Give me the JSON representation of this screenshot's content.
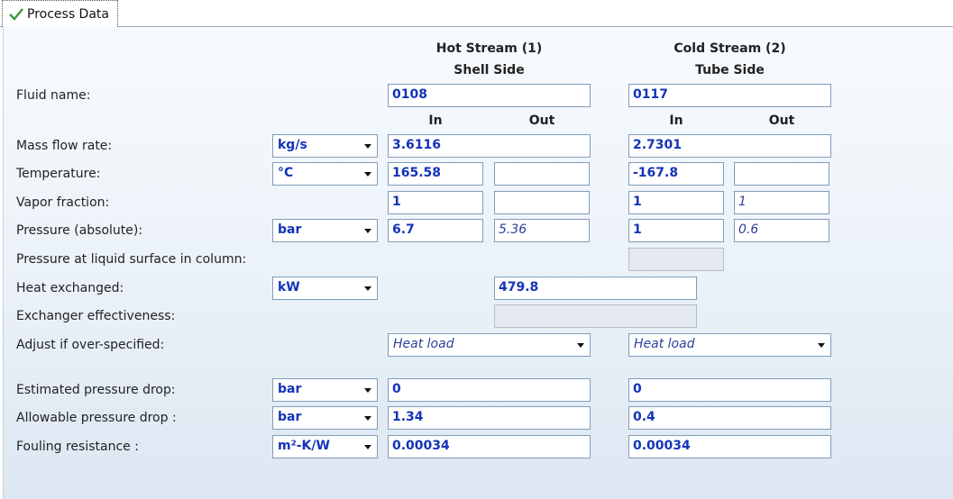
{
  "tab": {
    "label": "Process Data"
  },
  "headers": {
    "hot_title": "Hot Stream (1)",
    "hot_side": "Shell Side",
    "cold_title": "Cold Stream (2)",
    "cold_side": "Tube Side",
    "in": "In",
    "out": "Out"
  },
  "labels": {
    "fluid_name": "Fluid name:",
    "mass_flow": "Mass flow rate:",
    "temperature": "Temperature:",
    "vapor_fraction": "Vapor fraction:",
    "pressure": "Pressure (absolute):",
    "pressure_liquid": "Pressure at liquid surface in column:",
    "heat_exchanged": "Heat exchanged:",
    "effectiveness": "Exchanger effectiveness:",
    "adjust": "Adjust if over-specified:",
    "est_dp": "Estimated pressure drop:",
    "allow_dp": "Allowable pressure drop :",
    "fouling": "Fouling resistance :"
  },
  "units": {
    "mass_flow": "kg/s",
    "temperature": "°C",
    "pressure": "bar",
    "heat": "kW",
    "est_dp": "bar",
    "allow_dp": "bar",
    "fouling": "m²-K/W"
  },
  "hot": {
    "fluid_name": "0108",
    "mass_flow": "3.6116",
    "temp_in": "165.58",
    "temp_out": "",
    "vapor_in": "1",
    "vapor_out": "",
    "pressure_in": "6.7",
    "pressure_out": "5.36",
    "adjust": "Heat load",
    "est_dp": "0",
    "allow_dp": "1.34",
    "fouling": "0.00034"
  },
  "cold": {
    "fluid_name": "0117",
    "mass_flow": "2.7301",
    "temp_in": "-167.8",
    "temp_out": "",
    "vapor_in": "1",
    "vapor_out": "1",
    "pressure_in": "1",
    "pressure_out": "0.6",
    "pressure_liquid": "",
    "adjust": "Heat load",
    "est_dp": "0",
    "allow_dp": "0.4",
    "fouling": "0.00034"
  },
  "heat_exchanged": "479.8",
  "effectiveness": "",
  "colors": {
    "value_text": "#1433b8",
    "field_border": "#7f9db9",
    "check": "#3a9a3a"
  }
}
